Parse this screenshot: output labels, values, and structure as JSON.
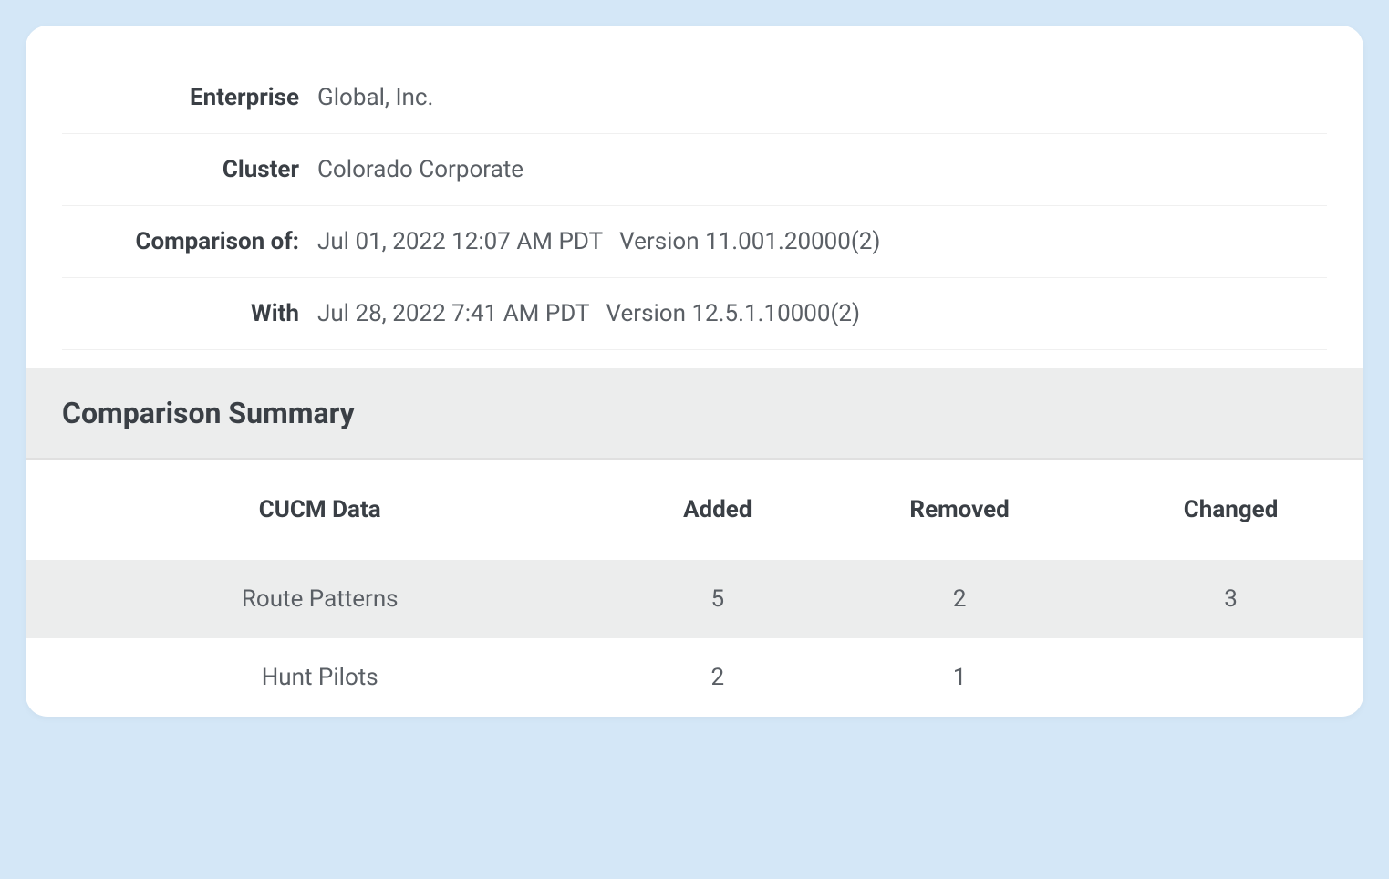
{
  "meta": {
    "enterprise_label": "Enterprise",
    "enterprise_value": "Global, Inc.",
    "cluster_label": "Cluster",
    "cluster_value": "Colorado Corporate",
    "comparison_label": "Comparison of:",
    "comparison_date": "Jul 01, 2022 12:07 AM PDT",
    "comparison_version": "Version 11.001.20000(2)",
    "with_label": "With",
    "with_date": "Jul 28, 2022 7:41 AM PDT",
    "with_version": "Version 12.5.1.10000(2)"
  },
  "summary_title": "Comparison Summary",
  "table": {
    "columns": [
      "CUCM Data",
      "Added",
      "Removed",
      "Changed"
    ],
    "rows": [
      {
        "name": "Route Patterns",
        "added": "5",
        "removed": "2",
        "changed": "3"
      },
      {
        "name": "Hunt Pilots",
        "added": "2",
        "removed": "1",
        "changed": ""
      }
    ]
  }
}
